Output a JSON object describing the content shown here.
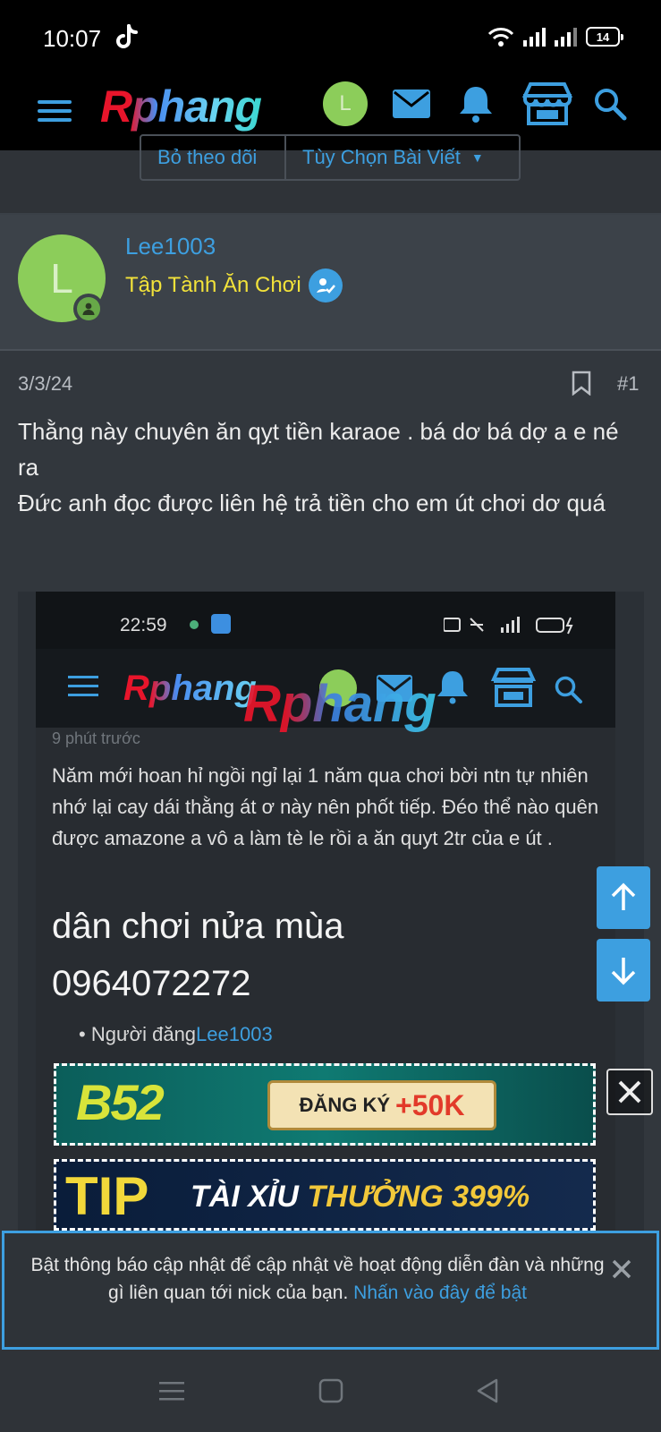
{
  "status_bar": {
    "time": "10:07",
    "battery": "14"
  },
  "header": {
    "logo": "Rphang",
    "avatar_letter": "L"
  },
  "subnav": {
    "unfollow": "Bỏ theo dõi",
    "post_options": "Tùy Chọn Bài Viết"
  },
  "post": {
    "author": "Lee1003",
    "author_title": "Tập Tành Ăn Chơi",
    "avatar_letter": "L",
    "date": "3/3/24",
    "number": "#1",
    "text_line1": "Thằng này chuyên ăn qỵt tiền karaoe . bá dơ bá dợ a e né ra",
    "text_line2": "Đức anh đọc được liên hệ trả tiền cho em út chơi dơ quá"
  },
  "embedded": {
    "time": "22:59",
    "logo": "Rphang",
    "watermark": "Rphang",
    "faded_line": "9 phút trước",
    "text": "Năm mới hoan hỉ ngồi ngỉ lại 1 năm qua chơi bời ntn tự nhiên nhớ lại cay dái thằng át ơ này nên phốt tiếp. Đéo thể nào quên được amazone a vô a làm tè le rồi a ăn quyt 2tr của e út .",
    "big_line1": "dân chơi nửa mùa",
    "big_line2": "0964072272",
    "list_label": "Người đăng",
    "list_value": "Lee1003"
  },
  "ads": {
    "banner1_brand": "B52",
    "banner1_cta": "ĐĂNG KÝ",
    "banner1_bonus": "+50K",
    "banner2_brand": "TIP",
    "banner2_text": "TÀI XỈU",
    "banner2_bonus": "THƯỞNG 399%"
  },
  "notification": {
    "text": "Bật thông báo cập nhật để cập nhật về hoạt động diễn đàn và những gì liên quan tới nick của bạn.",
    "link": "Nhấn vào đây để bật"
  },
  "colors": {
    "accent": "#3d9fe0",
    "avatar": "#8ccd5a",
    "title_yellow": "#f2e23a",
    "background": "#2f3338"
  }
}
